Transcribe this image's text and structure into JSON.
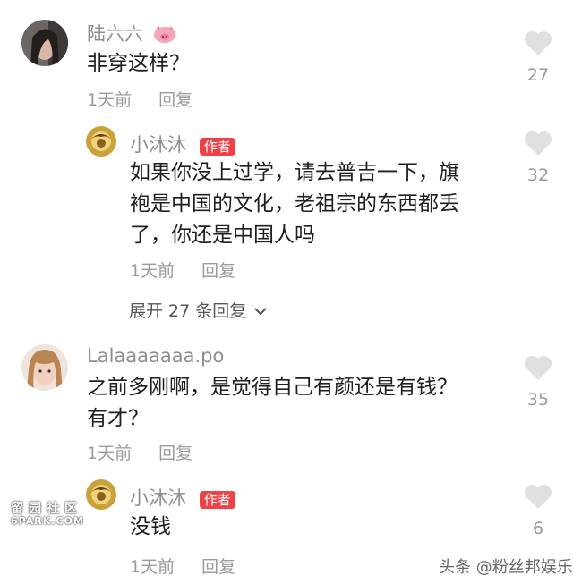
{
  "comments": [
    {
      "username": "陆六六",
      "text": "非穿这样？",
      "time": "1天前",
      "reply_label": "回复",
      "likes": "27"
    },
    {
      "username": "小沐沐",
      "badge": "作者",
      "text_lines": [
        "如果你没上过学，请去普吉一下，旗",
        "袍是中国的文化，老祖宗的东西都丢",
        "了，你还是中国人吗"
      ],
      "time": "1天前",
      "reply_label": "回复",
      "likes": "32"
    },
    {
      "username": "Lalaaaaaaa.po",
      "text_lines": [
        "之前多刚啊，是觉得自己有颜还是有钱？",
        "有才？"
      ],
      "time": "1天前",
      "reply_label": "回复",
      "likes": "35"
    },
    {
      "username": "小沐沐",
      "badge": "作者",
      "text": "没钱",
      "time": "1天前",
      "reply_label": "回复",
      "likes": "6"
    }
  ],
  "expand_replies": "展开 27 条回复",
  "watermark": {
    "site_chars": "留园社区",
    "site_url": "6PARK.COM",
    "credit": "头条 @粉丝邦娱乐"
  },
  "icons": {
    "pig": "pig-emoji-icon",
    "heart": "heart-icon",
    "chevron": "chevron-down-icon"
  },
  "colors": {
    "badge": "#f04147",
    "heart": "#e0e0e0"
  }
}
